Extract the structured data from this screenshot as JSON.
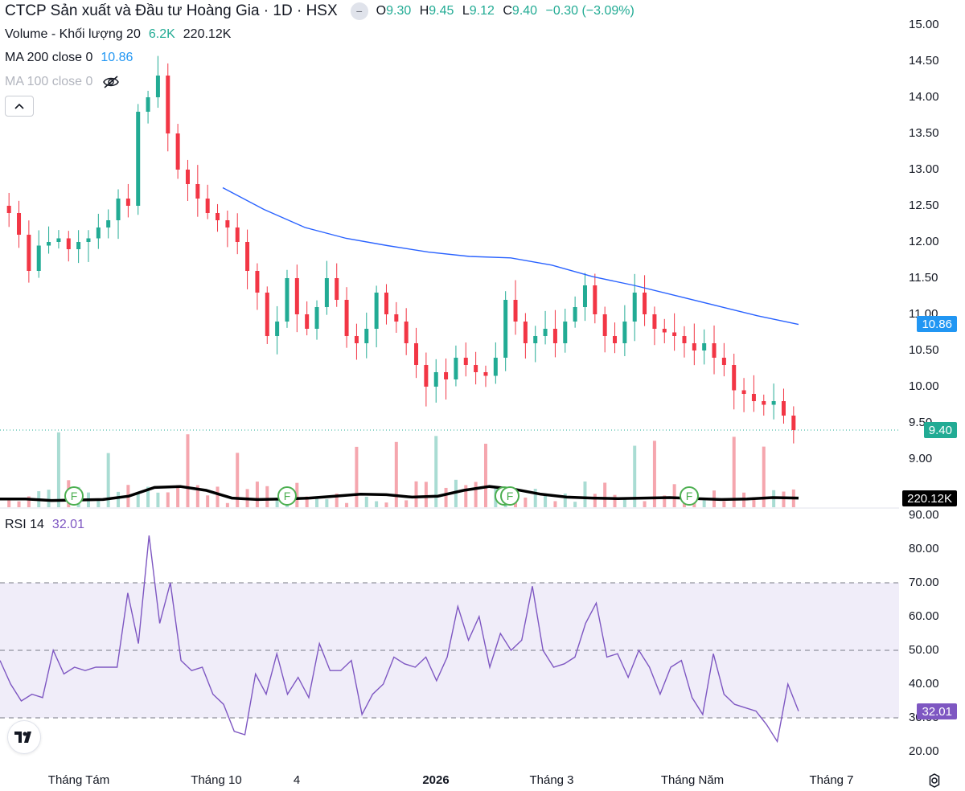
{
  "header": {
    "title": "CTCP Sản xuất và Đầu tư Hoàng Gia · 1D · HSX",
    "open_label": "O",
    "open_value": "9.30",
    "high_label": "H",
    "high_value": "9.45",
    "low_label": "L",
    "low_value": "9.12",
    "close_label": "C",
    "close_value": "9.40",
    "change": "−0.30 (−3.09%)"
  },
  "indicators": {
    "volume_label": "Volume - Khối lượng 20",
    "volume_value_1": "6.2K",
    "volume_value_2": "220.12K",
    "ma200_label": "MA 200 close 0",
    "ma200_value": "10.86",
    "ma100_label": "MA 100 close 0",
    "rsi_label": "RSI 14",
    "rsi_value": "32.01"
  },
  "price_axis": [
    "15.00",
    "14.50",
    "14.00",
    "13.50",
    "13.00",
    "12.50",
    "12.00",
    "11.50",
    "11.00",
    "10.50",
    "10.00",
    "9.50",
    "9.00"
  ],
  "rsi_axis": [
    "90.00",
    "80.00",
    "70.00",
    "60.00",
    "50.00",
    "40.00",
    "30.00",
    "20.00"
  ],
  "tags": {
    "ma200": "10.86",
    "last_price": "9.40",
    "volume_ma": "220.12K",
    "rsi": "32.01"
  },
  "time_axis": [
    {
      "label": "Tháng Tám",
      "bold": false
    },
    {
      "label": "Tháng 10",
      "bold": false
    },
    {
      "label": "4",
      "bold": false
    },
    {
      "label": "2026",
      "bold": true
    },
    {
      "label": "Tháng 3",
      "bold": false
    },
    {
      "label": "Tháng Năm",
      "bold": false
    },
    {
      "label": "Tháng 7",
      "bold": false
    }
  ],
  "event_markers": [
    "F",
    "F",
    "F",
    "F",
    "F"
  ],
  "colors": {
    "up": "#22ab94",
    "down": "#f23645",
    "ma200": "#2962ff",
    "rsi": "#7e57c2",
    "rsi_band": "#f0edf9",
    "volume_ma": "#000000"
  },
  "icons": {
    "collapse": "chevron-up-icon",
    "hidden": "eye-off-icon",
    "remove": "minus-icon",
    "settings": "gear-icon",
    "logo": "tradingview-logo"
  },
  "chart_data": {
    "type": "line",
    "title": "CTCP Sản xuất và Đầu tư Hoàng Gia · 1D · HSX",
    "ylim": [
      9.0,
      15.0
    ],
    "rsi_ylim": [
      20,
      90
    ],
    "rsi_bands": [
      30,
      50,
      70
    ],
    "last_price": 9.4,
    "ma200_last": 10.86,
    "rsi_last": 32.01,
    "price_series": {
      "name": "close",
      "values": [
        12.4,
        12.1,
        11.6,
        11.95,
        12.0,
        12.05,
        11.9,
        12.0,
        12.05,
        12.2,
        12.3,
        12.6,
        12.5,
        13.8,
        14.0,
        14.3,
        13.5,
        13.0,
        12.8,
        12.6,
        12.4,
        12.3,
        12.2,
        12.0,
        11.6,
        11.3,
        10.7,
        10.9,
        11.5,
        11.0,
        10.8,
        11.1,
        11.5,
        11.2,
        10.7,
        10.6,
        10.8,
        11.3,
        11.0,
        10.9,
        10.6,
        10.3,
        10.0,
        10.2,
        10.1,
        10.4,
        10.3,
        10.2,
        10.15,
        10.4,
        11.2,
        10.9,
        10.6,
        10.7,
        10.8,
        10.6,
        10.9,
        11.1,
        11.4,
        11.0,
        10.7,
        10.6,
        10.9,
        11.3,
        11.0,
        10.8,
        10.75,
        10.7,
        10.6,
        10.5,
        10.6,
        10.4,
        10.3,
        9.95,
        9.9,
        9.8,
        9.75,
        9.8,
        9.6,
        9.4
      ]
    },
    "ma200_series": {
      "name": "MA 200",
      "values": [
        12.75,
        12.45,
        12.2,
        12.05,
        11.95,
        11.86,
        11.8,
        11.78,
        11.68,
        11.52,
        11.4,
        11.26,
        11.12,
        10.98,
        10.86
      ]
    },
    "rsi_series": {
      "name": "RSI 14",
      "values": [
        47,
        40,
        35,
        37,
        36,
        50,
        43,
        45,
        44,
        45,
        45,
        45,
        67,
        52,
        84,
        58,
        70,
        47,
        44,
        45,
        37,
        34,
        26,
        25,
        43,
        37,
        49,
        37,
        42,
        36,
        52,
        44,
        44,
        47,
        31,
        37,
        40,
        48,
        46,
        45,
        48,
        41,
        48,
        63,
        53,
        60,
        45,
        55,
        50,
        53,
        69,
        50,
        45,
        46,
        48,
        58,
        64,
        48,
        49,
        42,
        50,
        45,
        37,
        45,
        47,
        36,
        31,
        49,
        37,
        34,
        33,
        32,
        28,
        23,
        40,
        32
      ]
    },
    "volume_ma_series": {
      "name": "Volume MA 20",
      "values": [
        0.6,
        0.6,
        0.45,
        0.5,
        0.55,
        0.9,
        1.8,
        1.9,
        1.5,
        0.7,
        0.55,
        0.6,
        0.7,
        0.9,
        1.1,
        1.05,
        0.8,
        0.9,
        1.5,
        1.9,
        1.6,
        1.1,
        0.8,
        0.7,
        0.65,
        0.7,
        0.75,
        0.65,
        0.55,
        0.6,
        0.75,
        0.7
      ]
    }
  }
}
